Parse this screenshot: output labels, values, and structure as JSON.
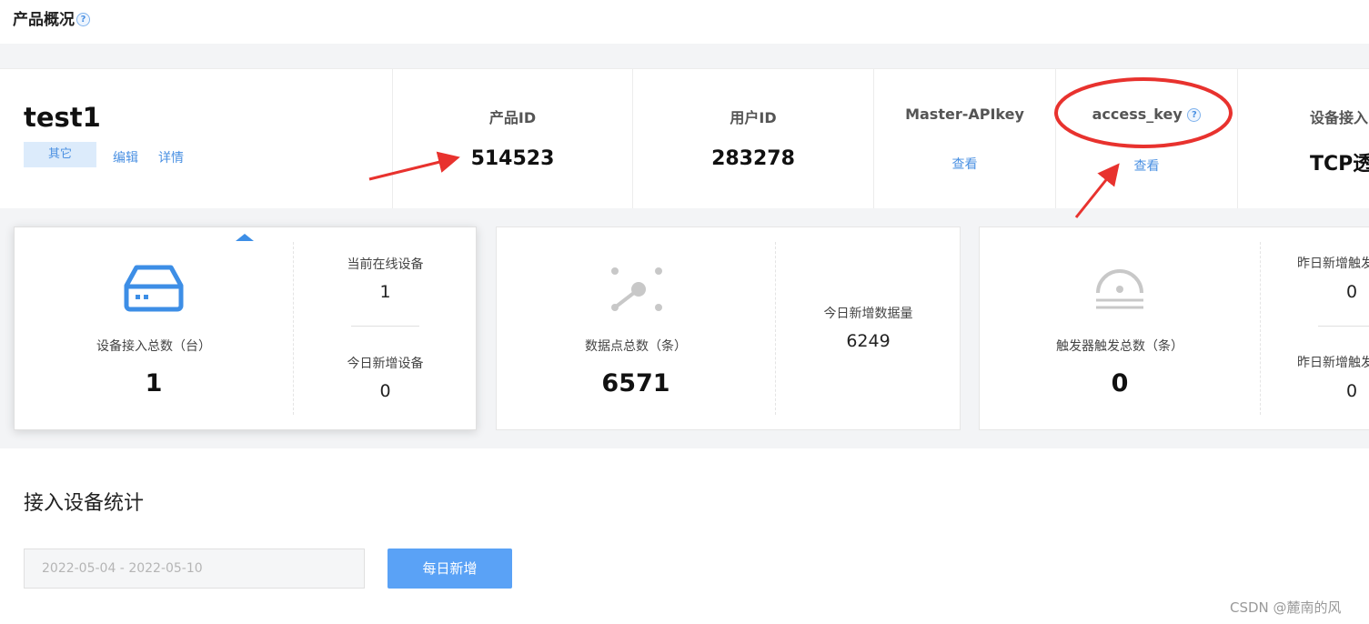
{
  "header": {
    "title": "产品概况",
    "help_icon": "question-circle-icon"
  },
  "product": {
    "name": "test1",
    "tag": "其它",
    "edit_label": "编辑",
    "detail_label": "详情"
  },
  "info_columns": [
    {
      "label": "产品ID",
      "value": "514523"
    },
    {
      "label": "用户ID",
      "value": "283278"
    },
    {
      "label": "Master-APIkey",
      "link": "查看"
    },
    {
      "label": "access_key",
      "link": "查看",
      "help_icon": "question-circle-icon"
    },
    {
      "label": "设备接入",
      "value": "TCP透"
    }
  ],
  "cards": [
    {
      "icon": "device-box-icon",
      "main_label": "设备接入总数（台）",
      "main_value": "1",
      "side": [
        {
          "label": "当前在线设备",
          "value": "1"
        },
        {
          "label": "今日新增设备",
          "value": "0"
        }
      ]
    },
    {
      "icon": "data-points-icon",
      "main_label": "数据点总数（条）",
      "main_value": "6571",
      "side": [
        {
          "label": "今日新增数据量",
          "value": "6249"
        }
      ]
    },
    {
      "icon": "trigger-icon",
      "main_label": "触发器触发总数（条）",
      "main_value": "0",
      "side": [
        {
          "label": "昨日新增触发",
          "value": "0"
        },
        {
          "label": "昨日新增触发",
          "value": "0"
        }
      ]
    }
  ],
  "section": {
    "title": "接入设备统计",
    "date_range_value": "2022-05-04 - 2022-05-10",
    "daily_button": "每日新增"
  },
  "watermark": "CSDN @麓南的风",
  "colors": {
    "accent": "#4a90e2",
    "button": "#5aa2f6",
    "annotation": "#e8322e"
  }
}
